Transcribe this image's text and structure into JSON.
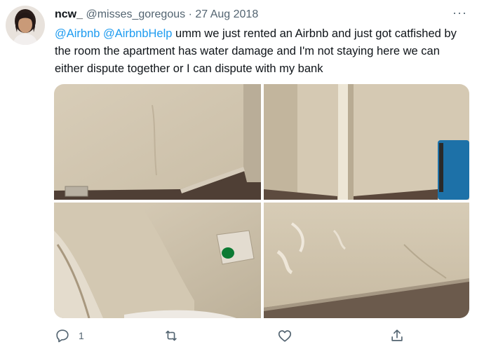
{
  "tweet": {
    "display_name": "ncw_",
    "handle": "@misses_goregous",
    "separator": "·",
    "date": "27 Aug 2018",
    "more": "···",
    "mentions": [
      "@Airbnb",
      "@AirbnbHelp"
    ],
    "body": "umm we just rented an Airbnb and just got catfished by the room the apartment has water damage and I'm not staying here we can either dispute together or I can dispute with my bank"
  },
  "actions": {
    "reply_count": "1",
    "retweet_count": "",
    "like_count": "",
    "icons": [
      "reply-icon",
      "retweet-icon",
      "like-icon",
      "share-icon"
    ]
  },
  "colors": {
    "accent": "#1d9bf0",
    "muted": "#536471",
    "text": "#0f1419"
  }
}
